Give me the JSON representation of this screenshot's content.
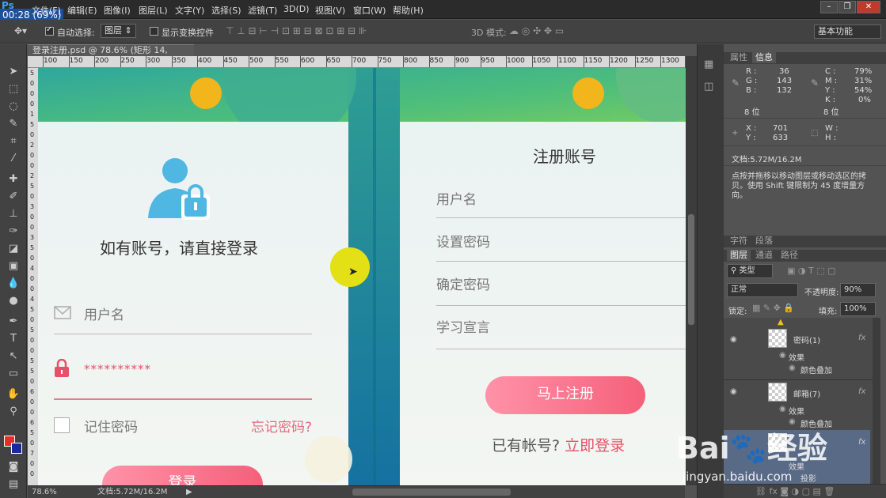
{
  "title_zoom": "00:28 (69%)",
  "menu": [
    "文件(F)",
    "编辑(E)",
    "图像(I)",
    "图层(L)",
    "文字(Y)",
    "选择(S)",
    "滤镜(T)",
    "3D(D)",
    "视图(V)",
    "窗口(W)",
    "帮助(H)"
  ],
  "options": {
    "auto_select": "自动选择:",
    "layer_select": "图层",
    "show_transform": "显示变换控件",
    "mode3d": "3D 模式:",
    "workspace": "基本功能"
  },
  "doc_tab": "登录注册.psd @ 78.6% (矩形 14, RGB/8)",
  "ruler_h": [
    "100",
    "150",
    "200",
    "250",
    "300",
    "350",
    "400",
    "450",
    "500",
    "550",
    "600",
    "650",
    "700",
    "750",
    "800",
    "850",
    "900",
    "950",
    "1000",
    "1050",
    "1100",
    "1150",
    "1200",
    "1250",
    "1300"
  ],
  "ruler_v": [
    "5",
    "0",
    "0",
    "0",
    "1",
    "5",
    "0",
    "2",
    "0",
    "0",
    "2",
    "5",
    "0",
    "3",
    "0",
    "0",
    "3",
    "5",
    "0",
    "4",
    "0",
    "0",
    "4",
    "5",
    "0",
    "5",
    "0",
    "0",
    "5",
    "5",
    "0",
    "6",
    "0",
    "0",
    "6",
    "5",
    "0",
    "7",
    "0",
    "0"
  ],
  "status": {
    "zoom": "78.6%",
    "doc": "文档:5.72M/16.2M"
  },
  "login": {
    "heading": "如有账号，请直接登录",
    "username": "用户名",
    "password": "**********",
    "remember": "记住密码",
    "forgot": "忘记密码?",
    "button": "登录"
  },
  "register": {
    "title": "注册账号",
    "fields": [
      "用户名",
      "设置密码",
      "确定密码",
      "学习宣言"
    ],
    "button": "马上注册",
    "have_account": "已有帐号?",
    "login_now": "立即登录"
  },
  "info_panel": {
    "tabs": [
      "属性",
      "信息"
    ],
    "R": "36",
    "G": "143",
    "B": "132",
    "bits1": "8 位",
    "C": "79%",
    "M": "31%",
    "Y2": "54%",
    "K": "0%",
    "bits2": "8 位",
    "X": "701",
    "Y": "633",
    "W": "",
    "H": "",
    "doc": "文档:5.72M/16.2M",
    "hint": "点按并拖移以移动图层或移动选区的拷贝。使用 Shift 键限制为 45 度增量方向。"
  },
  "char_tabs": [
    "字符",
    "段落"
  ],
  "layer_tabs": [
    "图层",
    "通道",
    "路径"
  ],
  "layers_panel": {
    "kind": "类型",
    "blend": "正常",
    "opacity_label": "不透明度:",
    "opacity": "90%",
    "lock": "锁定:",
    "fill_label": "填充:",
    "fill": "100%"
  },
  "layers": [
    {
      "name": "密码(1)",
      "effect": "效果",
      "sub": "颜色叠加"
    },
    {
      "name": "邮箱(7)",
      "effect": "效果",
      "sub": "颜色叠加"
    },
    {
      "name": "",
      "effect": "效果",
      "sub": "投影"
    }
  ],
  "watermark": "jingyan.baidu.com",
  "colors": {
    "pink": "#f5607a",
    "teal": "#1f8f86",
    "blue_icon": "#4fb7e2"
  }
}
